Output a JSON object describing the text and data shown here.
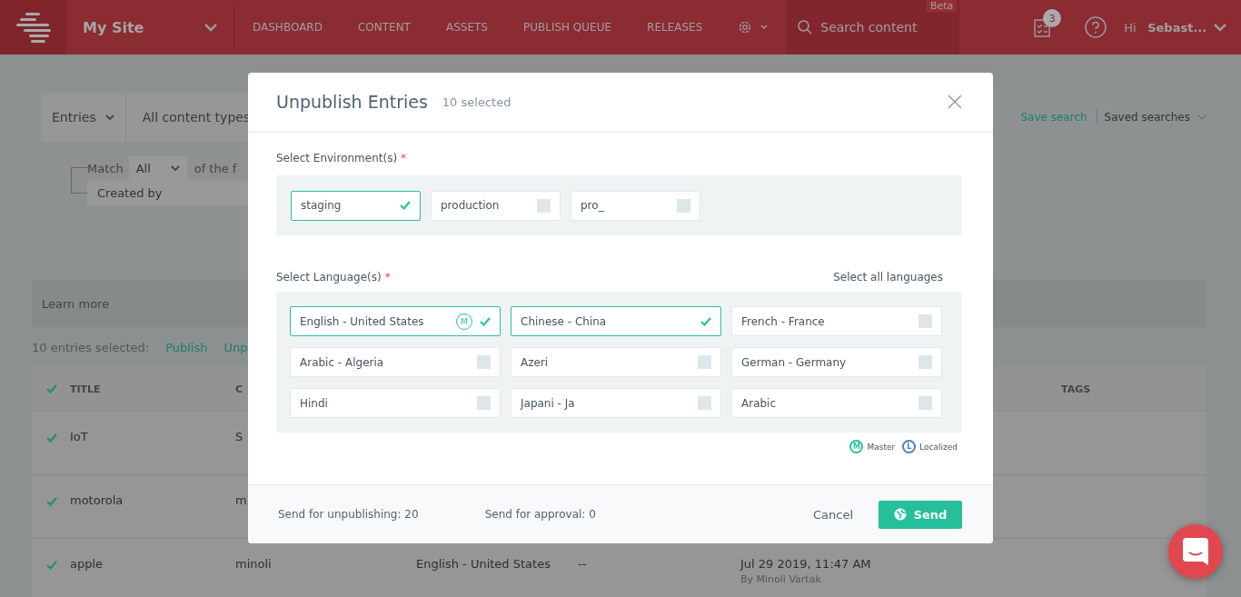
{
  "header": {
    "site": "My Site",
    "nav": [
      {
        "label": "DASHBOARD"
      },
      {
        "label": "CONTENT"
      },
      {
        "label": "ASSETS"
      },
      {
        "label": "PUBLISH QUEUE"
      },
      {
        "label": "RELEASES"
      }
    ],
    "search": {
      "placeholder": "Search content",
      "badge": "Beta"
    },
    "tasks_count": "3",
    "greeting": "Hi",
    "user": "Sebast..."
  },
  "filters": {
    "type": "Entries",
    "content_types": "All content types",
    "match_label": "Match",
    "match": "All",
    "match_suffix": "of the f",
    "condition": "Created by",
    "save_search": "Save search",
    "saved_searches": "Saved searches",
    "learn_more": "Learn more"
  },
  "bulk": {
    "count": "10 entries selected:",
    "actions": [
      {
        "label": "Publish"
      },
      {
        "label": "Unp"
      }
    ]
  },
  "table": {
    "columns": [
      "TITLE",
      "C",
      "TAGS"
    ],
    "rows": [
      {
        "checked": true,
        "title": "IoT",
        "column_2": "S"
      },
      {
        "checked": true,
        "title": "motorola",
        "column_2": "m"
      },
      {
        "checked": true,
        "title": "apple",
        "column_2": "minoli",
        "language": "English - United States",
        "column_4": "--",
        "date": "Jul 29 2019, 11:47 AM",
        "by": "By Minoli Vartak"
      }
    ]
  },
  "modal": {
    "title": "Unpublish Entries",
    "subtitle": "10 selected",
    "env_label": "Select Environment(s)",
    "required": "*",
    "environments": [
      {
        "label": "staging",
        "selected": true
      },
      {
        "label": "production",
        "selected": false
      },
      {
        "label": "pro_",
        "selected": false
      }
    ],
    "lang_label": "Select Language(s)",
    "select_all": "Select all languages",
    "languages": [
      {
        "label": "English - United States",
        "selected": true,
        "badge": "M"
      },
      {
        "label": "Chinese - China",
        "selected": true
      },
      {
        "label": "French - France",
        "selected": false
      },
      {
        "label": "Arabic - Algeria",
        "selected": false
      },
      {
        "label": "Azeri",
        "selected": false
      },
      {
        "label": "German - Germany",
        "selected": false
      },
      {
        "label": "Hindi",
        "selected": false
      },
      {
        "label": "Japani - Ja",
        "selected": false
      },
      {
        "label": "Arabic",
        "selected": false
      }
    ],
    "legend": [
      {
        "badge": "M",
        "label": "Master",
        "color": "#2bbf9c"
      },
      {
        "badge": "L",
        "label": "Localized",
        "color": "#4a80c0"
      }
    ],
    "footer": {
      "unpublishing": "Send for unpublishing: 20",
      "approval": "Send for approval: 0",
      "cancel": "Cancel",
      "send": "Send"
    }
  }
}
